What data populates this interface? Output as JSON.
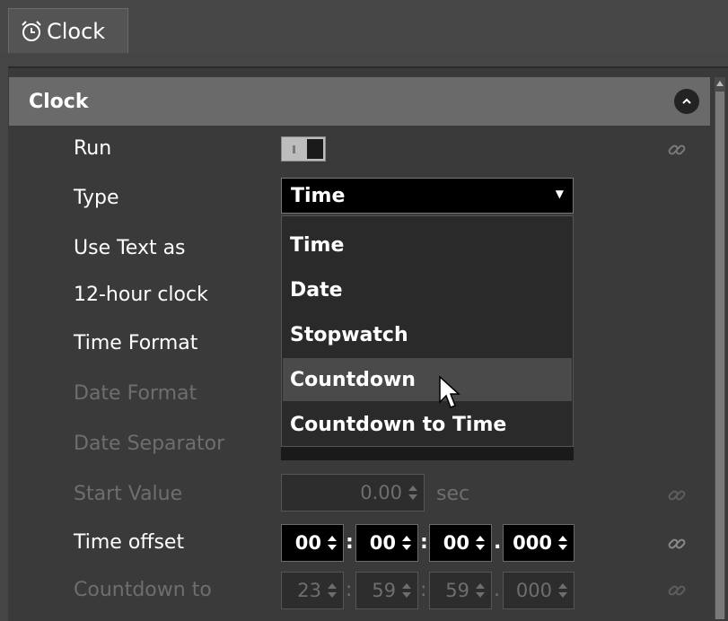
{
  "tab": {
    "label": "Clock",
    "icon": "alarm-clock-icon"
  },
  "section": {
    "title": "Clock",
    "collapse_icon": "chevron-up-icon"
  },
  "rows": {
    "run": "Run",
    "type": "Type",
    "use_text_as": "Use Text as",
    "hour12": "12-hour clock",
    "time_format": "Time Format",
    "date_format": "Date Format",
    "date_separator": "Date Separator",
    "start_value": "Start Value",
    "time_offset": "Time offset",
    "countdown_to": "Countdown to"
  },
  "type_select": {
    "selected": "Time",
    "options": [
      "Time",
      "Date",
      "Stopwatch",
      "Countdown",
      "Countdown to Time"
    ],
    "hovered": "Countdown"
  },
  "start_value": {
    "value": "0.00",
    "unit": "sec"
  },
  "time_offset": {
    "hh": "00",
    "mm": "00",
    "ss": "00",
    "ms": "000"
  },
  "countdown_to": {
    "hh": "23",
    "mm": "59",
    "ss": "59",
    "ms": "000"
  },
  "separators": {
    "colon": ":",
    "dot": "."
  }
}
